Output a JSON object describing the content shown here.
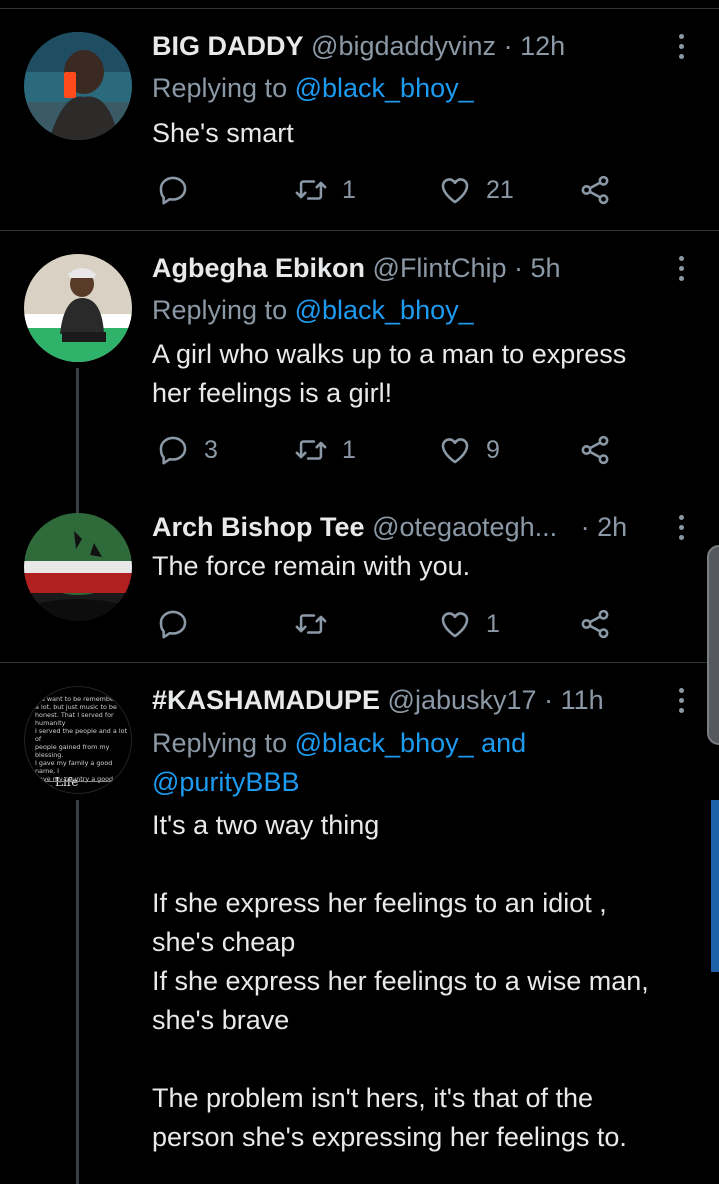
{
  "tweets": [
    {
      "name": "BIG DADDY",
      "handle": "@bigdaddyvinz",
      "sep": "·",
      "time": "12h",
      "replying_prefix": "Replying to ",
      "replying_to": "@black_bhoy_",
      "text": "She's smart",
      "reply_count": "",
      "retweet_count": "1",
      "like_count": "21"
    },
    {
      "name": "Agbegha Ebikon",
      "handle": "@FlintChip",
      "sep": "·",
      "time": "5h",
      "replying_prefix": "Replying to ",
      "replying_to": "@black_bhoy_",
      "text": "A girl who walks up to a man to express\nher feelings is a girl!",
      "reply_count": "3",
      "retweet_count": "1",
      "like_count": "9"
    },
    {
      "name": "Arch Bishop Tee",
      "handle": "@otegaotegh...",
      "sep": "·",
      "time": "2h",
      "text": "The force remain with you.",
      "reply_count": "",
      "retweet_count": "",
      "like_count": "1"
    },
    {
      "name": "#KASHAMADUPE",
      "handle": "@jabusky17",
      "sep": "·",
      "time": "11h",
      "replying_prefix": "Replying to ",
      "replying_to": "@black_bhoy_",
      "replying_and": " and",
      "replying_to_2": "@purityBBB",
      "text": "It's a two way thing\n\nIf she express her feelings to an idiot ,\nshe's cheap\nIf she express her feelings to a wise man,\nshe's brave\n\nThe problem isn't hers, it's that of the\nperson she's expressing her feelings to.",
      "avatar_text": "uld want to be remember\n a lot, but just music to be\n honest. That I served for humanity\n I served the people and a lot of\n people gained from my blessing.\n I gave my family a good name, I\n gave my country a good name.\n I gave Africans a good name\" -\n Wizkid-",
      "avatar_caption": "Life"
    }
  ],
  "colors": {
    "background": "#000000",
    "text": "#e7e9ea",
    "muted": "#8b98a5",
    "link": "#1d9bf0",
    "divider": "#2f3336"
  },
  "icons": [
    "reply-icon",
    "retweet-icon",
    "like-icon",
    "share-icon",
    "more-icon"
  ]
}
